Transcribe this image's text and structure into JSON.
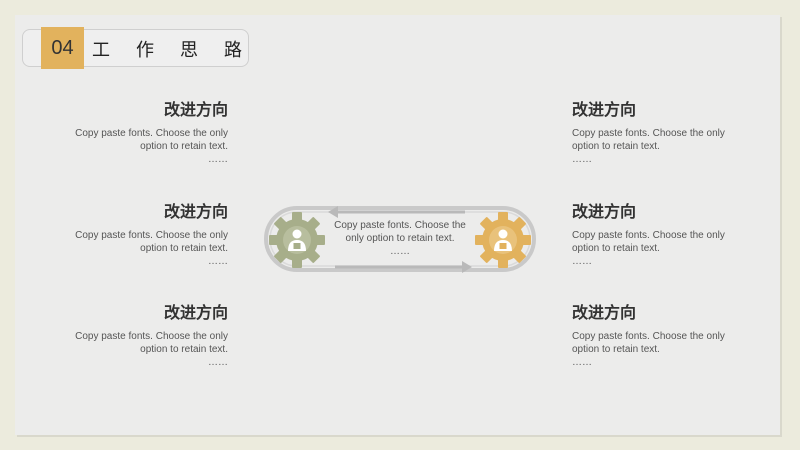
{
  "header": {
    "number": "04",
    "title": "工作思路"
  },
  "blocks": {
    "left": [
      {
        "title": "改进方向",
        "line1": "Copy paste fonts. Choose the only",
        "line2": "option to retain text.",
        "dots": "……"
      },
      {
        "title": "改进方向",
        "line1": "Copy paste fonts. Choose the only",
        "line2": "option to retain text.",
        "dots": "……"
      },
      {
        "title": "改进方向",
        "line1": "Copy paste fonts. Choose the only",
        "line2": "option to retain text.",
        "dots": "……"
      }
    ],
    "right": [
      {
        "title": "改进方向",
        "line1": "Copy paste fonts. Choose the only",
        "line2": "option to retain text.",
        "dots": "……"
      },
      {
        "title": "改进方向",
        "line1": "Copy paste fonts. Choose the only",
        "line2": "option to retain text.",
        "dots": "……"
      },
      {
        "title": "改进方向",
        "line1": "Copy paste fonts. Choose the only",
        "line2": "option to retain text.",
        "dots": "……"
      }
    ]
  },
  "center": {
    "line1": "Copy paste fonts. Choose the",
    "line2": "only option to retain text.",
    "dots": "……"
  },
  "colors": {
    "accent": "#e2b25d",
    "gear_left": "#a7ae8a",
    "gear_right": "#e2b25d"
  },
  "icons": {
    "left_gear": "gear-person-icon",
    "right_gear": "gear-person-icon"
  }
}
